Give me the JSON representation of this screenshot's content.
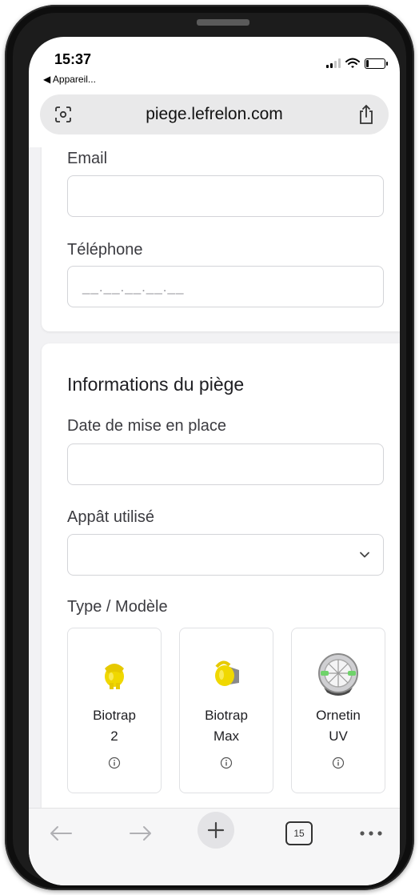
{
  "status": {
    "time": "15:37",
    "back_app": "◀ Appareil..."
  },
  "browser": {
    "url": "piege.lefrelon.com",
    "tab_count": "15"
  },
  "contact": {
    "email_label": "Email",
    "email_value": "",
    "phone_label": "Téléphone",
    "phone_placeholder": "__.__.__.__.__"
  },
  "trap_info": {
    "section_title": "Informations du piège",
    "date_label": "Date de mise en place",
    "date_value": "",
    "bait_label": "Appât utilisé",
    "bait_selected": "",
    "type_label": "Type / Modèle",
    "models": [
      {
        "name": "Biotrap\n2",
        "icon": "biotrap-2-image",
        "color": "#f0d800"
      },
      {
        "name": "Biotrap\nMax",
        "icon": "biotrap-max-image",
        "color": "#f0d800"
      },
      {
        "name": "Ornetin\nUV",
        "icon": "ornetin-uv-image",
        "color": "#9a9a9a"
      }
    ]
  },
  "colors": {
    "accent_yellow": "#f0d800",
    "uv_green": "#6fd36a"
  }
}
